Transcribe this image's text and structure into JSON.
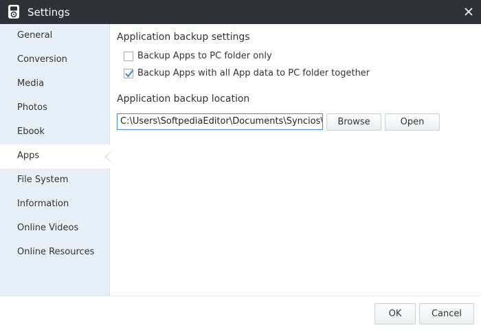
{
  "window": {
    "title": "Settings",
    "app_icon": "ipod-icon",
    "close_icon": "close-icon"
  },
  "sidebar": {
    "items": [
      {
        "label": "General"
      },
      {
        "label": "Conversion"
      },
      {
        "label": "Media"
      },
      {
        "label": "Photos"
      },
      {
        "label": "Ebook"
      },
      {
        "label": "Apps",
        "selected": true
      },
      {
        "label": "File System"
      },
      {
        "label": "Information"
      },
      {
        "label": "Online Videos"
      },
      {
        "label": "Online Resources"
      }
    ]
  },
  "main": {
    "backup_settings_title": "Application backup settings",
    "options": [
      {
        "label": "Backup Apps to PC folder only",
        "checked": false
      },
      {
        "label": "Backup Apps with all App data to PC folder together",
        "checked": true
      }
    ],
    "backup_location_title": "Application backup location",
    "path_value": "C:\\Users\\SoftpediaEditor\\Documents\\Syncios\\App",
    "browse_label": "Browse",
    "open_label": "Open"
  },
  "footer": {
    "ok_label": "OK",
    "cancel_label": "Cancel"
  },
  "colors": {
    "titlebar": "#2f3239",
    "sidebar_bg": "#e8f0f7",
    "accent": "#3a8ed8"
  }
}
